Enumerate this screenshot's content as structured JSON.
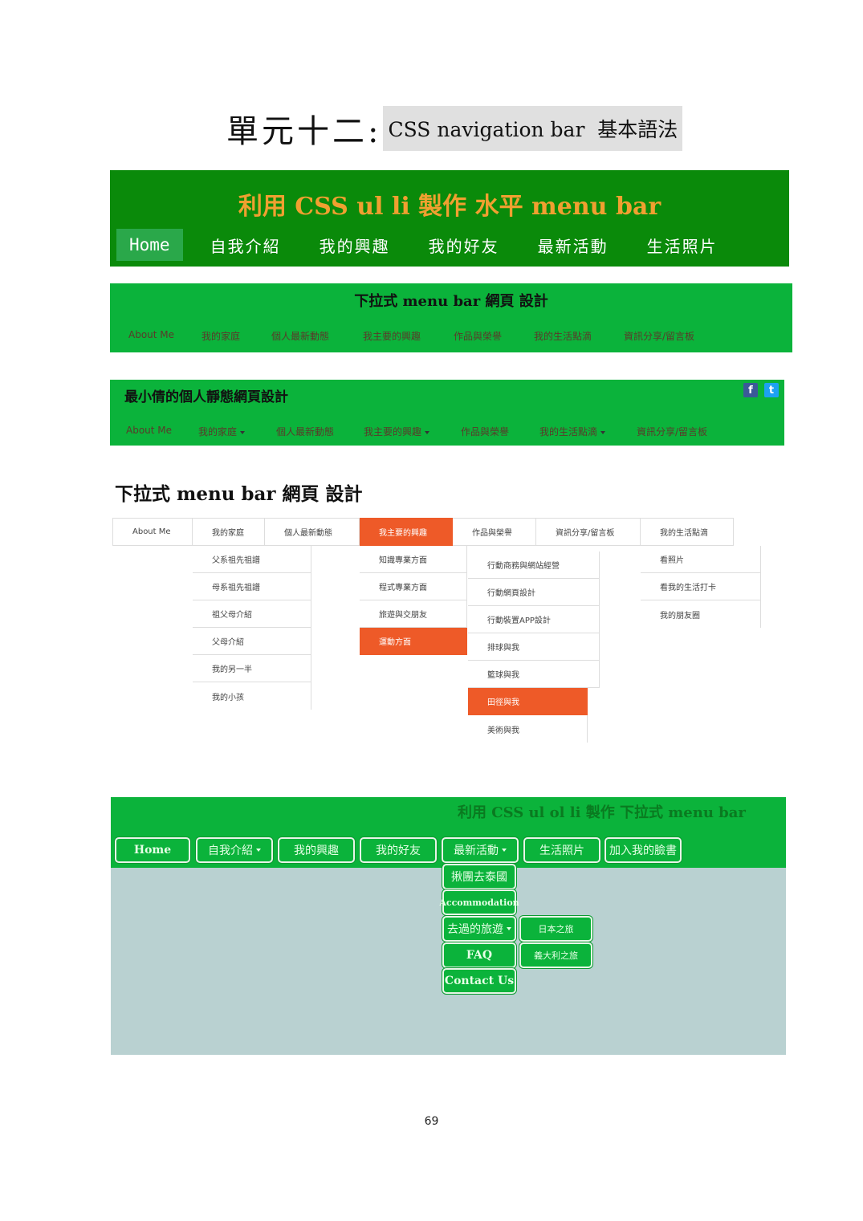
{
  "title": {
    "main": "單元十二:",
    "sub": "CSS navigation bar  基本語法"
  },
  "panel1": {
    "title": "利用 CSS ul li 製作 水平 menu bar",
    "nav": [
      "Home",
      "自我介紹",
      "我的興趣",
      "我的好友",
      "最新活動",
      "生活照片"
    ]
  },
  "panel2": {
    "title": "下拉式 menu bar 網頁 設計",
    "nav": [
      "About Me",
      "我的家庭",
      "個人最新動態",
      "我主要的興趣",
      "作品與榮譽",
      "我的生活點滴",
      "資訊分享/留言板"
    ]
  },
  "panel3": {
    "title": "最小倩的個人靜態網頁設計",
    "nav": [
      "About Me",
      "我的家庭",
      "個人最新動態",
      "我主要的興趣",
      "作品與榮譽",
      "我的生活點滴",
      "資訊分享/留言板"
    ],
    "social": {
      "facebook": "f",
      "twitter": "t"
    }
  },
  "section4": {
    "heading": "下拉式 menu bar 網頁 設計",
    "top": [
      "About Me",
      "我的家庭",
      "個人最新動態",
      "我主要的興趣",
      "作品與榮譽",
      "資訊分享/留言板",
      "我的生活點滴"
    ],
    "family_sub": [
      "父系祖先祖譜",
      "母系祖先祖譜",
      "祖父母介紹",
      "父母介紹",
      "我的另一半",
      "我的小孩"
    ],
    "interest_sub": [
      "知識專業方面",
      "程式專業方面",
      "旅遊與交朋友",
      "運動方面"
    ],
    "sport_sub": [
      "行動商務與網站經營",
      "行動網頁設計",
      "行動裝置APP設計",
      "排球與我",
      "籃球與我",
      "田徑與我",
      "美術與我"
    ],
    "life_sub": [
      "看照片",
      "看我的生活打卡",
      "我的朋友圈"
    ]
  },
  "panel5": {
    "title": "利用 CSS ul ol li 製作 下拉式 menu bar",
    "nav": [
      "Home",
      "自我介紹",
      "我的興趣",
      "我的好友",
      "最新活動",
      "生活照片",
      "加入我的臉書"
    ],
    "dropdown": [
      "揪團去泰國",
      "Accommodation",
      "去過的旅遊",
      "FAQ",
      "Contact Us"
    ],
    "sub_dropdown": [
      "日本之旅",
      "義大利之旅"
    ]
  },
  "page_number": "69"
}
